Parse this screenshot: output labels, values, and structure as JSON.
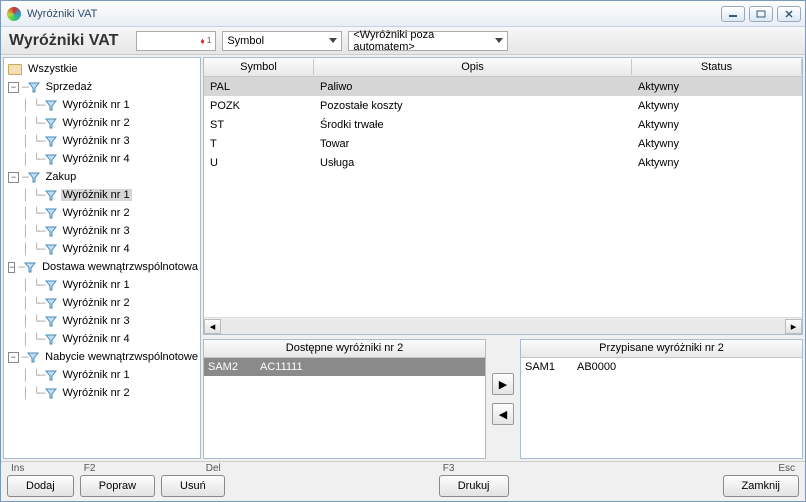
{
  "window": {
    "title": "Wyróżniki VAT"
  },
  "header": {
    "title": "Wyróżniki VAT",
    "sort_field": "Symbol",
    "filter": "<Wyróżniki poza automatem>"
  },
  "tree": {
    "root": "Wszystkie",
    "groups": [
      {
        "label": "Sprzedaż",
        "items": [
          "Wyróżnik nr 1",
          "Wyróżnik nr 2",
          "Wyróżnik nr 3",
          "Wyróżnik nr 4"
        ],
        "sel": -1
      },
      {
        "label": "Zakup",
        "items": [
          "Wyróżnik nr 1",
          "Wyróżnik nr 2",
          "Wyróżnik nr 3",
          "Wyróżnik nr 4"
        ],
        "sel": 0
      },
      {
        "label": "Dostawa wewnątrzwspólnotowa",
        "items": [
          "Wyróżnik nr 1",
          "Wyróżnik nr 2",
          "Wyróżnik nr 3",
          "Wyróżnik nr 4"
        ],
        "sel": -1
      },
      {
        "label": "Nabycie wewnątrzwspólnotowe",
        "items": [
          "Wyróżnik nr 1",
          "Wyróżnik nr 2"
        ],
        "sel": -1
      }
    ]
  },
  "grid": {
    "cols": [
      "Symbol",
      "Opis",
      "Status"
    ],
    "rows": [
      {
        "symbol": "PAL",
        "opis": "Paliwo",
        "status": "Aktywny",
        "sel": true
      },
      {
        "symbol": "POZK",
        "opis": "Pozostałe koszty",
        "status": "Aktywny"
      },
      {
        "symbol": "ST",
        "opis": "Środki trwałe",
        "status": "Aktywny"
      },
      {
        "symbol": "T",
        "opis": "Towar",
        "status": "Aktywny"
      },
      {
        "symbol": "U",
        "opis": "Usługa",
        "status": "Aktywny"
      }
    ]
  },
  "available": {
    "title": "Dostępne wyróżniki nr 2",
    "rows": [
      {
        "code": "SAM2",
        "name": "AC11111",
        "sel": true
      }
    ]
  },
  "assigned": {
    "title": "Przypisane wyróżniki nr 2",
    "rows": [
      {
        "code": "SAM1",
        "name": "AB0000"
      }
    ]
  },
  "footer": {
    "add": {
      "hint": "Ins",
      "label": "Dodaj"
    },
    "edit": {
      "hint": "F2",
      "label": "Popraw"
    },
    "del": {
      "hint": "Del",
      "label": "Usuń"
    },
    "print": {
      "hint": "F3",
      "label": "Drukuj"
    },
    "close": {
      "hint": "Esc",
      "label": "Zamknij"
    }
  }
}
